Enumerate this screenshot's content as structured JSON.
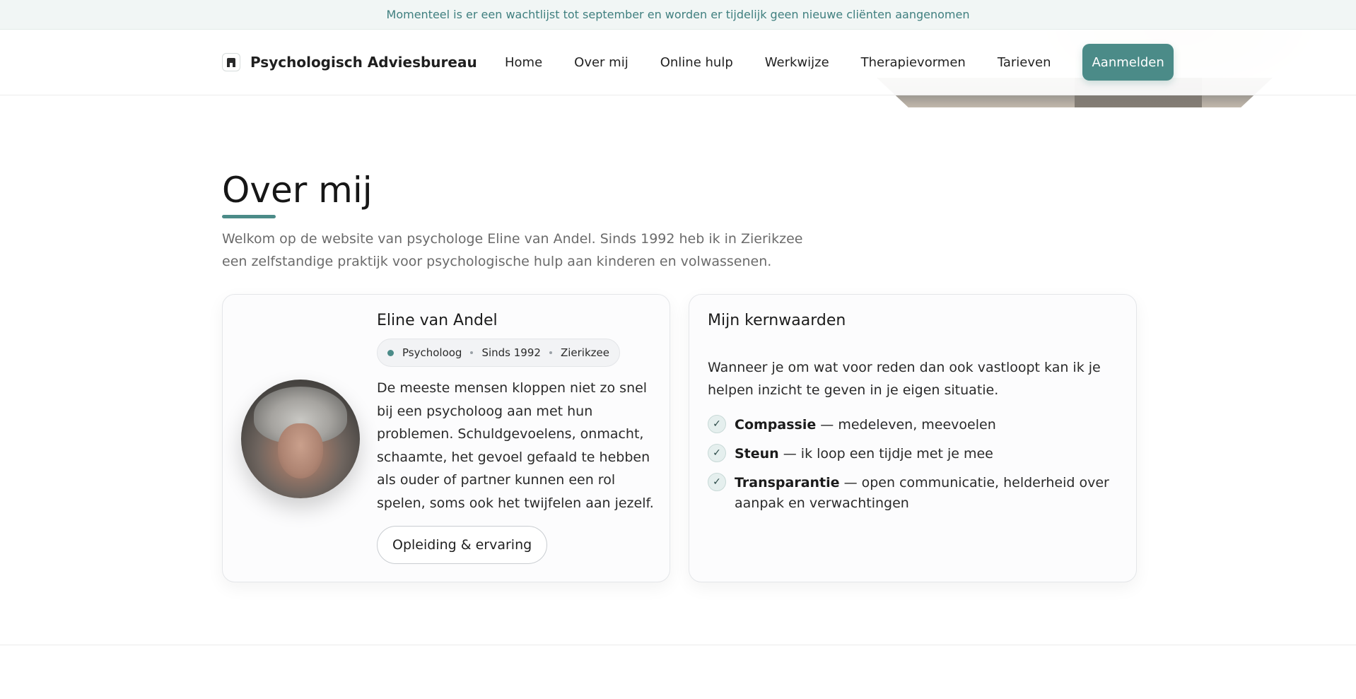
{
  "announcement": "Momenteel is er een wachtlijst tot september en worden er tijdelijk geen nieuwe cliënten aangenomen",
  "brand": {
    "name": "Psychologisch Adviesbureau",
    "logo_icon": "building-icon"
  },
  "nav": {
    "items": [
      {
        "label": "Home"
      },
      {
        "label": "Over mij"
      },
      {
        "label": "Online hulp"
      },
      {
        "label": "Werkwijze"
      },
      {
        "label": "Therapievormen"
      },
      {
        "label": "Tarieven"
      }
    ],
    "cta": "Aanmelden"
  },
  "section": {
    "title": "Over mij",
    "intro": "Welkom op de website van psychologe Eline van Andel. Sinds 1992 heb ik in Zierikzee een zelfstandige praktijk voor psychologische hulp aan kinderen en volwassenen."
  },
  "profile": {
    "name": "Eline van Andel",
    "chips": [
      "Psycholoog",
      "Sinds 1992",
      "Zierikzee"
    ],
    "bio": "De meeste mensen kloppen niet zo snel bij een psycholoog aan met hun problemen. Schuldgevoelens, onmacht, schaamte, het gevoel gefaald te hebben als ouder of partner kunnen een rol spelen, soms ook het twijfelen aan jezelf.",
    "button": "Opleiding & ervaring"
  },
  "values": {
    "title": "Mijn kernwaarden",
    "intro": "Wanneer je om wat voor reden dan ook vastloopt kan ik je helpen inzicht te geven in je eigen situatie.",
    "items": [
      {
        "term": "Compassie",
        "desc": " — medeleven, meevoelen"
      },
      {
        "term": "Steun",
        "desc": " — ik loop een tijdje met je mee"
      },
      {
        "term": "Transparantie",
        "desc": " — open communicatie, helderheid over aanpak en verwachtingen"
      }
    ],
    "check_icon": "✓"
  },
  "colors": {
    "accent": "#4b8b88",
    "announcement_text": "#3f7f7f"
  }
}
